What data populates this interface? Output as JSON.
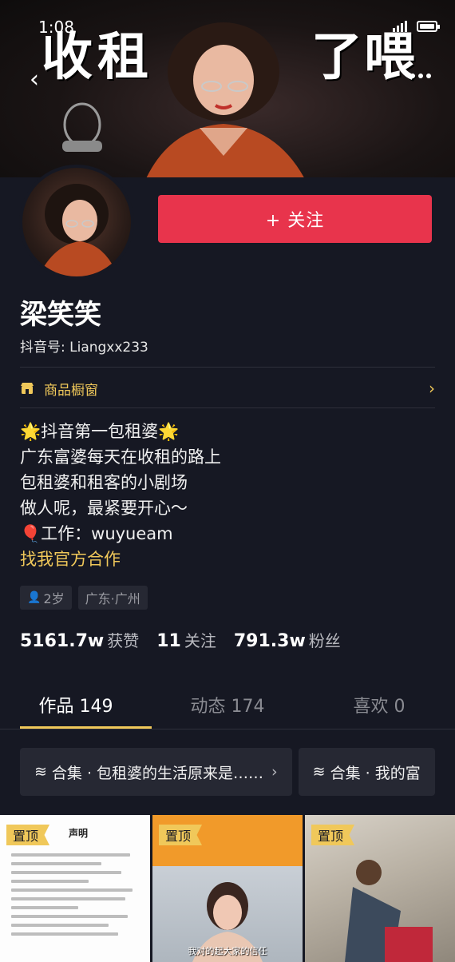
{
  "status": {
    "time": "1:08"
  },
  "banner": {
    "title_left": "收租",
    "title_right": "了喂"
  },
  "nav": {
    "back_icon": "back-arrow-icon",
    "more_icon": "more-dots-icon"
  },
  "profile": {
    "name": "梁笑笑",
    "douyin_id": "抖音号: Liangxx233",
    "follow_label": "+ 关注"
  },
  "shop": {
    "label": "商品橱窗",
    "icon": "shop-icon"
  },
  "bio": {
    "line1": "🌟抖音第一包租婆🌟",
    "line2": "广东富婆每天在收租的路上",
    "line3": "包租婆和租客的小剧场",
    "line4": "做人呢，最紧要开心～",
    "line5": "🎈工作：wuyueam",
    "link": "找我官方合作"
  },
  "tags": {
    "age": "2岁",
    "location": "广东·广州"
  },
  "stats": {
    "likes_num": "5161.7w",
    "likes_label": "获赞",
    "following_num": "11",
    "following_label": "关注",
    "fans_num": "791.3w",
    "fans_label": "粉丝"
  },
  "tabs": [
    {
      "label": "作品 149"
    },
    {
      "label": "动态 174"
    },
    {
      "label": "喜欢 0"
    }
  ],
  "collections": [
    {
      "label": "合集 · 包租婆的生活原来是……"
    },
    {
      "label": "合集 · 我的富"
    }
  ],
  "videos": [
    {
      "pin": "置顶",
      "doc_title": "声明"
    },
    {
      "pin": "置顶",
      "caption": "我对的起大家的信任"
    },
    {
      "pin": "置顶"
    }
  ],
  "colors": {
    "accent": "#e8344c",
    "gold": "#f0c85a",
    "background": "#161823"
  }
}
